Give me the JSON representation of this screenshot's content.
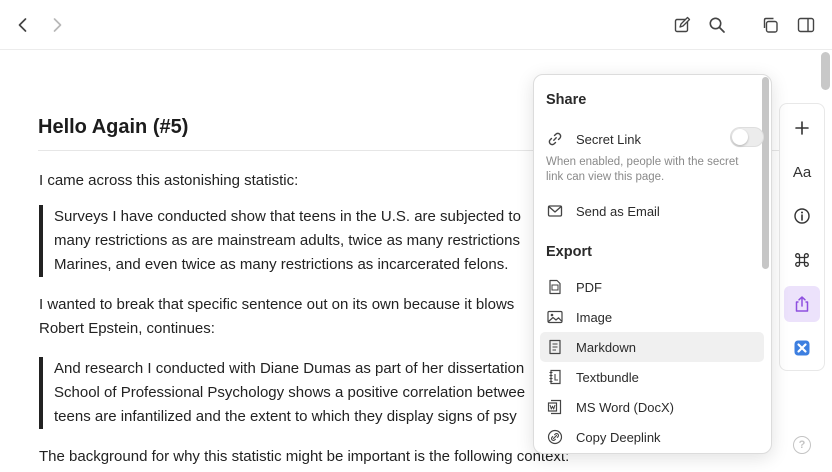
{
  "editor": {
    "title": "Hello Again (#5)",
    "p1": "I came across this astonishing statistic:",
    "quote1": [
      "Surveys I have conducted show that teens in the U.S. are subjected to",
      "many restrictions as are mainstream adults, twice as many restrictions",
      "Marines, and even twice as many restrictions as incarcerated felons."
    ],
    "p2_lines": [
      "I wanted to break that specific sentence out on its own because it blows",
      "Robert Epstein, continues:"
    ],
    "quote2": [
      "And research I conducted with Diane Dumas as part of her dissertation",
      "School of Professional Psychology shows a positive correlation betwee",
      "teens are infantilized and the extent to which they display signs of psy"
    ],
    "p3": "The background for why this statistic might be important is the following context:"
  },
  "share_menu": {
    "share_heading": "Share",
    "secret_link_label": "Secret Link",
    "secret_link_enabled": false,
    "secret_link_description": "When enabled, people with the secret link can view this page.",
    "send_email_label": "Send as Email",
    "export_heading": "Export",
    "export_items": [
      {
        "label": "PDF",
        "icon": "pdf-file-icon"
      },
      {
        "label": "Image",
        "icon": "image-icon"
      },
      {
        "label": "Markdown",
        "icon": "markdown-file-icon"
      },
      {
        "label": "Textbundle",
        "icon": "textbundle-icon"
      },
      {
        "label": "MS Word (DocX)",
        "icon": "word-file-icon"
      },
      {
        "label": "Copy Deeplink",
        "icon": "link-icon"
      }
    ]
  },
  "side_actions": {
    "font_label": "Aa",
    "help_label": "?"
  },
  "colors": {
    "accent": "#9b59e6",
    "active_bg": "#ece2fb",
    "quote_bar": "#222222"
  }
}
